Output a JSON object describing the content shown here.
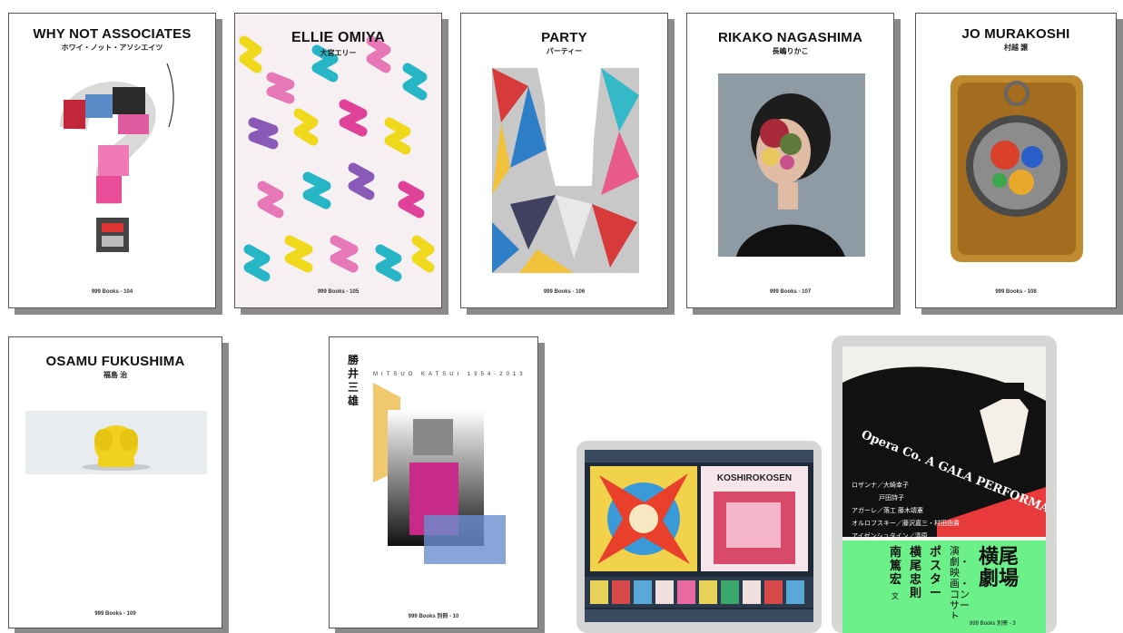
{
  "books": [
    {
      "title": "WHY NOT ASSOCIATES",
      "subtitle": "ホワイ・ノット・アソシエイツ",
      "footer": "999 Books - 104"
    },
    {
      "title": "ELLIE OMIYA",
      "subtitle": "大宮エリー",
      "footer": "999 Books - 105"
    },
    {
      "title": "PARTY",
      "subtitle": "パーティー",
      "footer": "999 Books - 106"
    },
    {
      "title": "RIKAKO NAGASHIMA",
      "subtitle": "長嶋りかこ",
      "footer": "999 Books - 107"
    },
    {
      "title": "JO MURAKOSHI",
      "subtitle": "村越 譲",
      "footer": "999 Books - 108"
    },
    {
      "title": "OSAMU FUKUSHIMA",
      "subtitle": "福島 治",
      "footer": "999 Books - 109"
    },
    {
      "title_vertical": "勝井三雄",
      "title": "MITSUO KATSUI 1954-2013",
      "footer": "999 Books 別冊 - 10"
    }
  ],
  "tablet_small": {
    "heading": "KOSHIROKOSEN"
  },
  "tablet_large": {
    "arc_text": "Opera Co. A GALA PERFORMANCE",
    "names": [
      "ロザンナ／大崎幸子",
      "戸田詩子",
      "アガーレ／落工 藤木靖憲",
      "オルロフスキー／藤沢嘉三・村田由貴",
      "アイゼンシュタイン／清原"
    ],
    "title_right": "横尾劇場",
    "subtitle_mid": "演劇・映画・コンサート",
    "poster": "ポスター",
    "author": "横尾忠則",
    "writer": "南篤宏",
    "writer_suffix": "文",
    "footer": "999 Books 別冊 - 3"
  }
}
